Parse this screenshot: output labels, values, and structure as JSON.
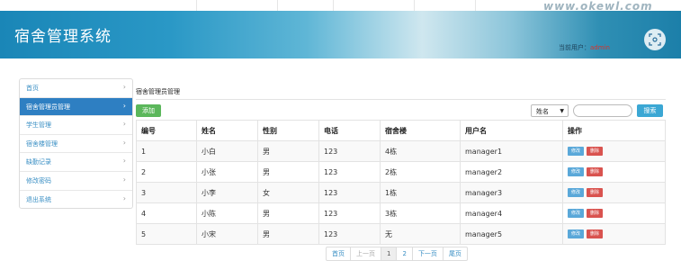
{
  "watermark": "www.okewl.com",
  "header": {
    "title": "宿舍管理系统",
    "user_prefix": "当前用户：",
    "user_name": "admin"
  },
  "sidebar": {
    "items": [
      {
        "label": "首页",
        "active": false
      },
      {
        "label": "宿舍管理员管理",
        "active": true
      },
      {
        "label": "学生管理",
        "active": false
      },
      {
        "label": "宿舍楼管理",
        "active": false
      },
      {
        "label": "缺勤记录",
        "active": false
      },
      {
        "label": "修改密码",
        "active": false
      },
      {
        "label": "退出系统",
        "active": false
      }
    ],
    "chevron": "›"
  },
  "panel": {
    "title": "宿舍管理员管理",
    "add_label": "添加",
    "search_field": "姓名",
    "search_placeholder": "",
    "search_label": "搜索"
  },
  "table": {
    "columns": [
      "编号",
      "姓名",
      "性别",
      "电话",
      "宿舍楼",
      "用户名",
      "操作"
    ],
    "rows": [
      {
        "id": "1",
        "name": "小白",
        "sex": "男",
        "phone": "123",
        "building": "4栋",
        "username": "manager1"
      },
      {
        "id": "2",
        "name": "小张",
        "sex": "男",
        "phone": "123",
        "building": "2栋",
        "username": "manager2"
      },
      {
        "id": "3",
        "name": "小李",
        "sex": "女",
        "phone": "123",
        "building": "1栋",
        "username": "manager3"
      },
      {
        "id": "4",
        "name": "小陈",
        "sex": "男",
        "phone": "123",
        "building": "3栋",
        "username": "manager4"
      },
      {
        "id": "5",
        "name": "小宋",
        "sex": "男",
        "phone": "123",
        "building": "无",
        "username": "manager5"
      }
    ],
    "edit_label": "修改",
    "delete_label": "删除"
  },
  "pager": {
    "first": "首页",
    "prev": "上一页",
    "pages": [
      "1",
      "2"
    ],
    "next": "下一页",
    "last": "尾页"
  },
  "colors": {
    "header_blue": "#1a86b7",
    "active_nav": "#2e7fc2",
    "add_button": "#5bb75b",
    "edit_button": "#5aa8d9",
    "delete_button": "#d9534f",
    "user_name": "#d9332b"
  }
}
